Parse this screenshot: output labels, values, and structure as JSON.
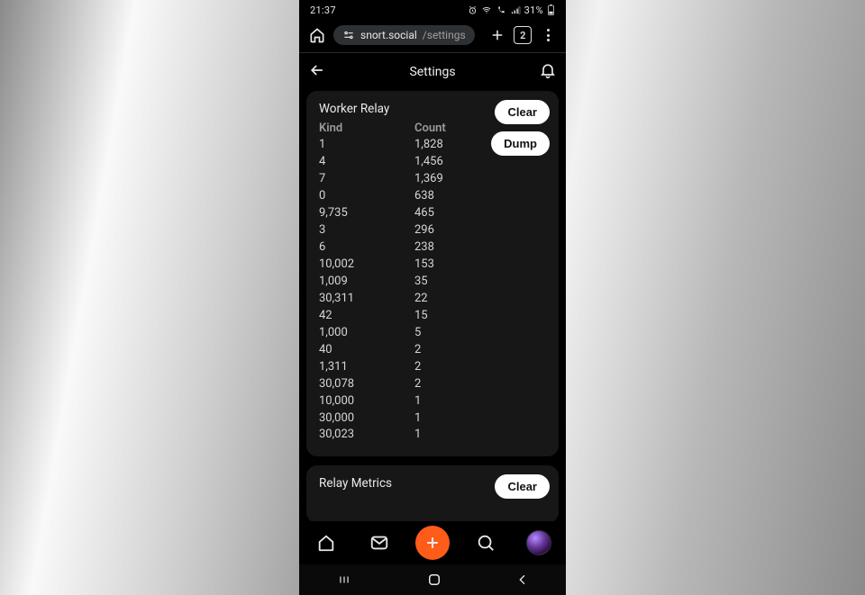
{
  "statusbar": {
    "time": "21:37",
    "battery": "31%"
  },
  "browser": {
    "host": "snort.social",
    "path": "/settings",
    "tab_count": "2"
  },
  "page": {
    "title": "Settings"
  },
  "worker_relay": {
    "title": "Worker Relay",
    "clear_label": "Clear",
    "dump_label": "Dump",
    "columns": {
      "kind": "Kind",
      "count": "Count"
    },
    "rows": [
      {
        "kind": "1",
        "count": "1,828"
      },
      {
        "kind": "4",
        "count": "1,456"
      },
      {
        "kind": "7",
        "count": "1,369"
      },
      {
        "kind": "0",
        "count": "638"
      },
      {
        "kind": "9,735",
        "count": "465"
      },
      {
        "kind": "3",
        "count": "296"
      },
      {
        "kind": "6",
        "count": "238"
      },
      {
        "kind": "10,002",
        "count": "153"
      },
      {
        "kind": "1,009",
        "count": "35"
      },
      {
        "kind": "30,311",
        "count": "22"
      },
      {
        "kind": "42",
        "count": "15"
      },
      {
        "kind": "1,000",
        "count": "5"
      },
      {
        "kind": "40",
        "count": "2"
      },
      {
        "kind": "1,311",
        "count": "2"
      },
      {
        "kind": "30,078",
        "count": "2"
      },
      {
        "kind": "10,000",
        "count": "1"
      },
      {
        "kind": "30,000",
        "count": "1"
      },
      {
        "kind": "30,023",
        "count": "1"
      }
    ]
  },
  "relay_metrics": {
    "title": "Relay Metrics",
    "clear_label": "Clear"
  }
}
